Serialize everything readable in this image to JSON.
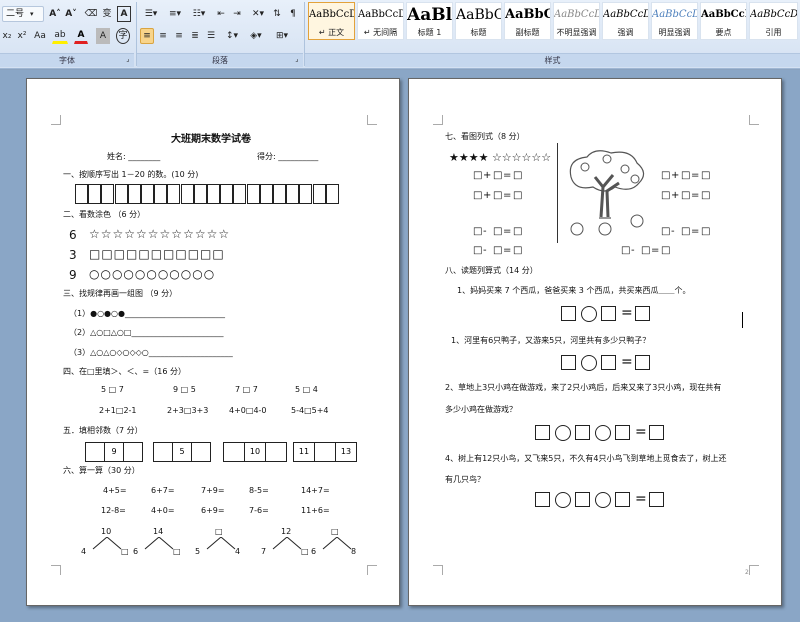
{
  "ribbon": {
    "font_size_value": "二号",
    "font_group_label": "字体",
    "paragraph_group_label": "段落",
    "styles_group_label": "样式",
    "style_tiles": [
      {
        "sample": "AaBbCcDc",
        "name": "↵ 正文"
      },
      {
        "sample": "AaBbCcDc",
        "name": "↵ 无间隔"
      },
      {
        "sample": "AaBl",
        "name": "标题 1"
      },
      {
        "sample": "AaBbC",
        "name": "标题"
      },
      {
        "sample": "AaBbC",
        "name": "副标题"
      },
      {
        "sample": "AaBbCcD",
        "name": "不明显强调"
      },
      {
        "sample": "AaBbCcD",
        "name": "强调"
      },
      {
        "sample": "AaBbCcD",
        "name": "明显强调"
      },
      {
        "sample": "AaBbCcD",
        "name": "要点"
      },
      {
        "sample": "AaBbCcD",
        "name": "引用"
      }
    ],
    "toolbar_glyphs": {
      "grow_font": "A˄",
      "shrink_font": "A˅",
      "phonetic": "变",
      "char_border": "A",
      "bold_sub": "x₂",
      "superscript": "x²",
      "change_case": "Aa",
      "highlight": "ab",
      "font_color": "A",
      "char_shading": "A",
      "enclose": "字"
    }
  },
  "page1": {
    "title": "大班期末数学试卷",
    "name_label": "姓名: ________",
    "score_label": "得分: __________",
    "q1": "一、按顺序写出 1－20 的数。(10 分)",
    "q2": "二、看数涂色 （6 分）",
    "q2_rows": [
      {
        "num": "6",
        "shapes": "☆☆☆☆☆☆☆☆☆☆☆☆"
      },
      {
        "num": "3",
        "shapes": "□□□□□□□□□□□"
      },
      {
        "num": "9",
        "shapes": "○○○○○○○○○○○"
      }
    ],
    "q3": "三、找规律再画一组图 （9 分）",
    "q3_rows": [
      "（1）●○●○●_________________________",
      "（2）△○□△○□_______________________",
      "（3）△○△○◇○◇◇○_____________________"
    ],
    "q4": "四、在□里填＞、＜、=（16 分）",
    "q4_row1": [
      "5  □  7",
      "9  □  5",
      "7  □  7",
      "5  □  4"
    ],
    "q4_row2": [
      "2+1□2-1",
      "2+3□3+3",
      "4+0□4-0",
      "5-4□5+4"
    ],
    "q5": "五．填相邻数（7 分）",
    "q5_cells": [
      "9",
      "5",
      "10",
      "11",
      "13"
    ],
    "q6": "六、算一算（30 分）",
    "q6_row1": [
      "4+5=",
      "6+7=",
      "7+9=",
      "8-5=",
      "14+7="
    ],
    "q6_row2": [
      "12-8=",
      "4+0=",
      "6+9=",
      "7-6=",
      "11+6="
    ],
    "q6_trees": [
      {
        "top": "10",
        "left": "4",
        "right": "□"
      },
      {
        "top": "14",
        "left": "6",
        "right": "□"
      },
      {
        "top": "□",
        "left": "5",
        "right": "4"
      },
      {
        "top": "12",
        "left": "7",
        "right": "□"
      },
      {
        "top": "□",
        "left": "6",
        "right": "8"
      }
    ]
  },
  "page2": {
    "q7": "七、看图列式（8 分）",
    "stars": "★★★★ ☆☆☆☆☆☆",
    "q8": "八、读题列算式（14 分）",
    "p1": "1、妈妈买来 7 个西瓜，爸爸买来 3 个西瓜，共买来西瓜＿＿个。",
    "p2": "1、河里有6只鸭子，又游来5只，河里共有多少只鸭子？",
    "p3a": "2、草地上3只小鸡在做游戏，来了2只小鸡后，后来又来了3只小鸡，现在共有",
    "p3b": "多少小鸡在做游戏？",
    "p4a": "4、树上有12只小鸟，又飞来5只，不久有4只小鸟飞到草地上觅食去了，树上还",
    "p4b": "有几只鸟？",
    "page_mark": "2"
  }
}
